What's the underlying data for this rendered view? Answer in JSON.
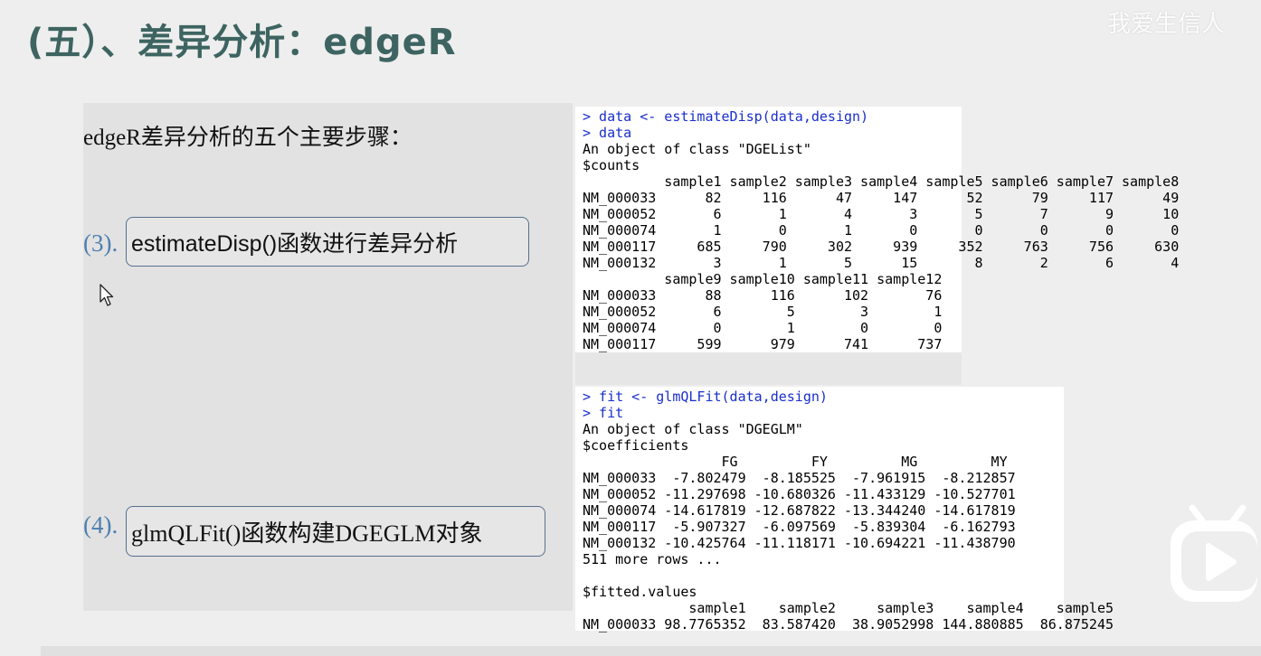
{
  "slide": {
    "title": "(五）、差异分析：edgeR",
    "watermark": "我爱生信人"
  },
  "steps": {
    "intro": "edgeR差异分析的五个主要步骤：",
    "items": [
      {
        "number": "(3).",
        "label": "estimateDisp()函数进行差异分析"
      },
      {
        "number": "(4).",
        "label": "glmQLFit()函数构建DGEGLM对象"
      }
    ]
  },
  "console1": {
    "commands": [
      "> data <- estimateDisp(data,design)",
      "> data"
    ],
    "output": "An object of class \"DGEList\"\n$counts\n          sample1 sample2 sample3 sample4 sample5 sample6 sample7 sample8\nNM_000033      82     116      47     147      52      79     117      49\nNM_000052       6       1       4       3       5       7       9      10\nNM_000074       1       0       1       0       0       0       0       0\nNM_000117     685     790     302     939     352     763     756     630\nNM_000132       3       1       5      15       8       2       6       4\n          sample9 sample10 sample11 sample12\nNM_000033      88      116      102       76\nNM_000052       6        5        3        1\nNM_000074       0        1        0        0\nNM_000117     599      979      741      737"
  },
  "console2": {
    "commands": [
      "> fit <- glmQLFit(data,design)",
      "> fit"
    ],
    "output": "An object of class \"DGEGLM\"\n$coefficients\n                 FG         FY         MG         MY\nNM_000033  -7.802479  -8.185525  -7.961915  -8.212857\nNM_000052 -11.297698 -10.680326 -11.433129 -10.527701\nNM_000074 -14.617819 -12.687822 -13.344240 -14.617819\nNM_000117  -5.907327  -6.097569  -5.839304  -6.162793\nNM_000132 -10.425764 -11.118171 -10.694221 -11.438790\n511 more rows ...\n\n$fitted.values\n             sample1    sample2     sample3    sample4    sample5\nNM_000033 98.7765352  83.587420  38.9052998 144.880885  86.875245"
  },
  "colors": {
    "title": "#3d6460",
    "step_number": "#4d7fb0",
    "command": "#1a2ecc"
  },
  "icons": [
    "mouse-cursor-icon",
    "bilibili-play-icon"
  ]
}
